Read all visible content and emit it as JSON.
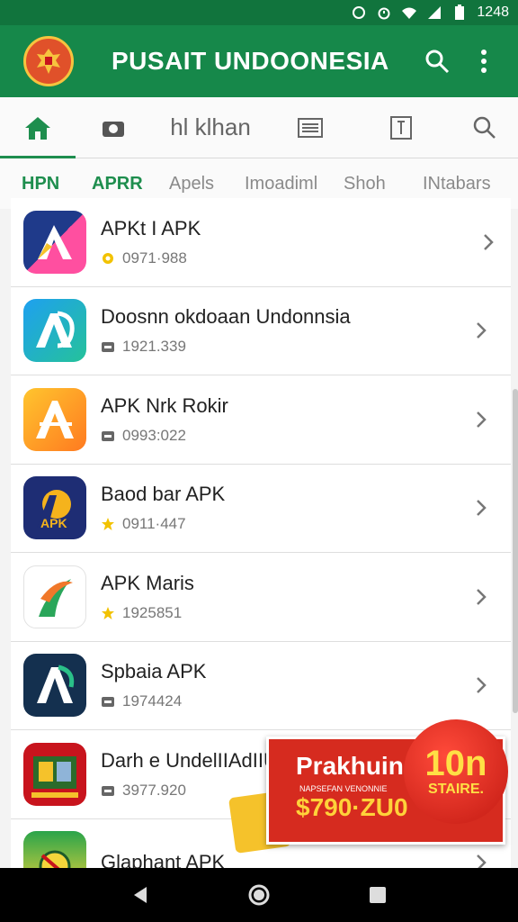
{
  "status_bar": {
    "time": "1248"
  },
  "app_bar": {
    "title": "PUSAIT UNDOONESIA"
  },
  "toolbar": {
    "text_tab": "hl klhan"
  },
  "category_tabs": [
    "HPN",
    "APRR",
    "Apels",
    "Imoadiml",
    "Shoh",
    "INtabars"
  ],
  "apps": [
    {
      "title": "APKt I APK",
      "meta": "0971·988",
      "meta_icon": "star-icon",
      "icon_colors": [
        "#1f3a8a",
        "#ff4fa0"
      ]
    },
    {
      "title": "Doosnn okdoaan Undonnsia",
      "meta": "1921.339",
      "meta_icon": "storage-icon",
      "icon_colors": [
        "#1ea0f0",
        "#25c29a"
      ]
    },
    {
      "title": "APK Nrk Rokir",
      "meta": "0993:022",
      "meta_icon": "storage-icon",
      "icon_colors": [
        "#ffb72a",
        "#ff7a20"
      ]
    },
    {
      "title": "Baod bar APK",
      "meta": "0911·447",
      "meta_icon": "star-icon",
      "icon_colors": [
        "#1e2d74",
        "#f5b31c"
      ]
    },
    {
      "title": "APK Maris",
      "meta": "1925851",
      "meta_icon": "star-icon",
      "icon_colors": [
        "#ffffff",
        "#2aa65a"
      ]
    },
    {
      "title": "Spbaia APK",
      "meta": "1974424",
      "meta_icon": "storage-icon",
      "icon_colors": [
        "#14304f",
        "#2ac089"
      ]
    },
    {
      "title": "Darh e UndelIIAdIIU",
      "meta": "3977.920",
      "meta_icon": "storage-icon",
      "icon_colors": [
        "#c8141d",
        "#2b6b2b"
      ]
    },
    {
      "title": "Glaphant APK",
      "meta": "",
      "meta_icon": "",
      "icon_colors": [
        "#2aa44a",
        "#f3d53b"
      ]
    }
  ],
  "ad": {
    "headline": "Prakhuin",
    "subline": "NAPSEFAN VENONNIE",
    "price": "$790·ZU0",
    "badge_big": "10n",
    "badge_small": "STAIRE."
  },
  "colors": {
    "brand_green": "#16884a",
    "status_green": "#11743d",
    "accent": "#1e8e4e",
    "ad_red": "#d62b1f"
  }
}
